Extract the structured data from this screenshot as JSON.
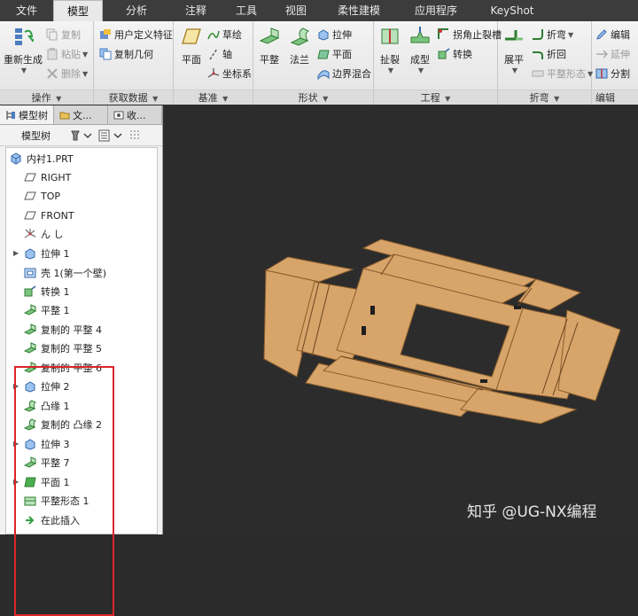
{
  "ribbon_tabs": [
    "文件",
    "模型",
    "分析",
    "注释",
    "工具",
    "视图",
    "柔性建模",
    "应用程序",
    "KeyShot"
  ],
  "ribbon": {
    "operations": {
      "regenerate": "重新生成",
      "copy": "复制",
      "paste": "粘贴",
      "delete": "删除",
      "label": "操作"
    },
    "get_data": {
      "udf": "用户定义特征",
      "copy_geometry": "复制几何",
      "label": "获取数据"
    },
    "datum": {
      "plane": "平面",
      "sketch": "草绘",
      "axis": "轴",
      "csys": "坐标系",
      "label": "基准"
    },
    "shapes": {
      "flat": "平整",
      "flange": "法兰",
      "extrude": "拉伸",
      "plane": "平面",
      "boundary_blend": "边界混合",
      "label": "形状"
    },
    "engineering": {
      "rip": "扯裂",
      "form": "成型",
      "corner_relief": "拐角止裂槽",
      "convert": "转换",
      "label": "工程"
    },
    "bends": {
      "unbend": "展平",
      "bend": "折弯",
      "bend_back": "折回",
      "flat_state": "平整形态",
      "label": "折弯"
    },
    "edit": {
      "edit": "编辑",
      "extend": "延伸",
      "split": "分割",
      "label": "编辑"
    }
  },
  "panel": {
    "tabs": [
      "模型树",
      "文...",
      "收..."
    ],
    "toolbar_label": "模型树",
    "tree": [
      {
        "label": "内衬1.PRT",
        "icon": "part-icon"
      },
      {
        "label": "RIGHT",
        "icon": "datum-plane-icon"
      },
      {
        "label": "TOP",
        "icon": "datum-plane-icon"
      },
      {
        "label": "FRONT",
        "icon": "datum-plane-icon"
      },
      {
        "label": "ん し",
        "icon": "csys-icon"
      },
      {
        "label": "拉伸 1",
        "icon": "extrude-icon"
      },
      {
        "label": "壳 1(第一个壁)",
        "icon": "shell-icon"
      },
      {
        "label": "转换 1",
        "icon": "convert-icon"
      },
      {
        "label": "平整 1",
        "icon": "flat-wall-icon"
      },
      {
        "label": "复制的 平整 4",
        "icon": "flat-wall-icon"
      },
      {
        "label": "复制的 平整 5",
        "icon": "flat-wall-icon"
      },
      {
        "label": "复制的 平整 6",
        "icon": "flat-wall-icon"
      },
      {
        "label": "拉伸 2",
        "icon": "extrude-icon"
      },
      {
        "label": "凸缘 1",
        "icon": "flange-icon"
      },
      {
        "label": "复制的 凸缘 2",
        "icon": "flange-icon"
      },
      {
        "label": "拉伸 3",
        "icon": "extrude-icon"
      },
      {
        "label": "平整 7",
        "icon": "flat-wall-icon"
      },
      {
        "label": "平面 1",
        "icon": "flat-wall-green-icon"
      },
      {
        "label": "平整形态 1",
        "icon": "flat-state-icon"
      },
      {
        "label": "在此插入",
        "icon": "insert-here-icon"
      }
    ]
  },
  "watermark": "知乎 @UG-NX编程",
  "colors": {
    "ribbon_bg": "#e9e9e9",
    "viewport_bg": "#2c2c2c",
    "model_fill": "#d7a46a",
    "highlight_border": "#d9262b"
  }
}
